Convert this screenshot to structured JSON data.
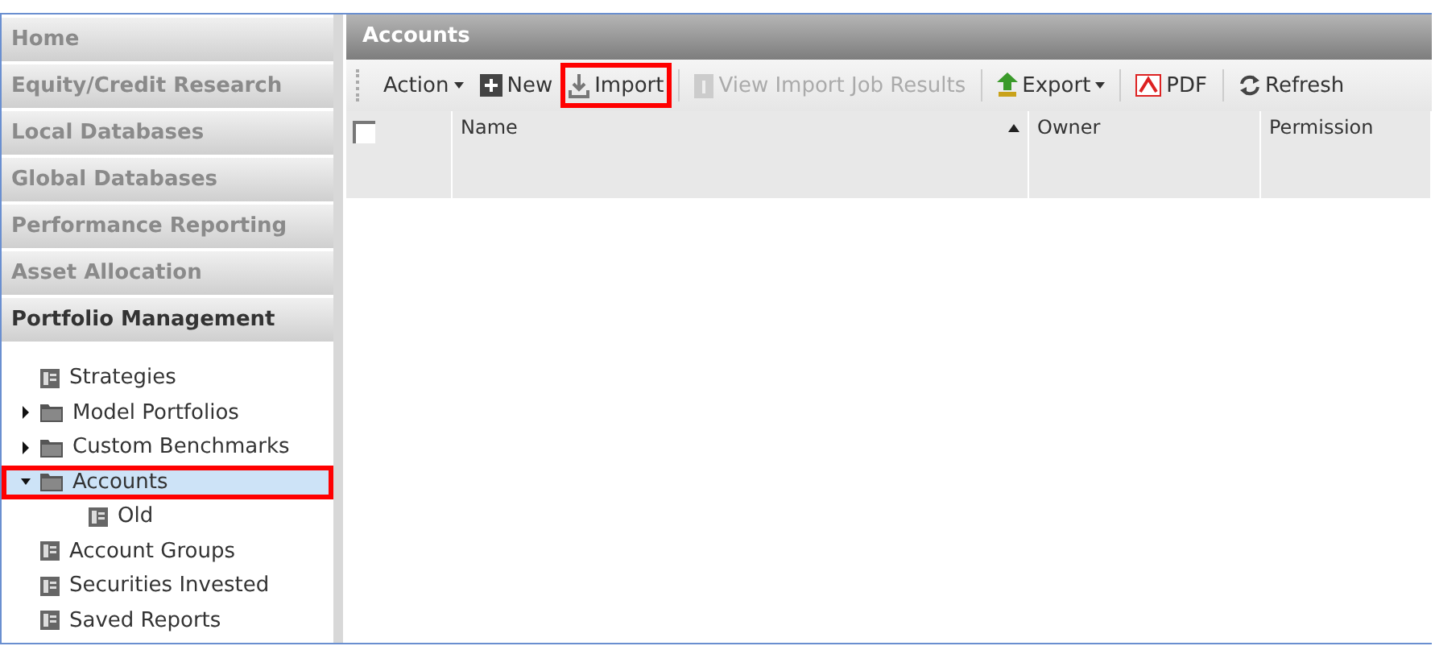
{
  "nav": [
    {
      "label": "Home",
      "selected": false
    },
    {
      "label": "Equity/Credit Research",
      "selected": false
    },
    {
      "label": "Local Databases",
      "selected": false
    },
    {
      "label": "Global Databases",
      "selected": false
    },
    {
      "label": "Performance Reporting",
      "selected": false
    },
    {
      "label": "Asset Allocation",
      "selected": false
    },
    {
      "label": "Portfolio Management",
      "selected": true
    }
  ],
  "tree": [
    {
      "label": "Strategies",
      "kind": "doc",
      "selected": false,
      "highlighted": false
    },
    {
      "label": "Model Portfolios",
      "kind": "folder",
      "expanded": false,
      "selected": false,
      "highlighted": false
    },
    {
      "label": "Custom Benchmarks",
      "kind": "folder",
      "expanded": false,
      "selected": false,
      "highlighted": false
    },
    {
      "label": "Accounts",
      "kind": "folder",
      "expanded": true,
      "selected": true,
      "highlighted": true,
      "children": [
        {
          "label": "Old",
          "kind": "doc",
          "selected": false,
          "highlighted": false
        }
      ]
    },
    {
      "label": "Account Groups",
      "kind": "doc",
      "selected": false,
      "highlighted": false
    },
    {
      "label": "Securities Invested",
      "kind": "doc",
      "selected": false,
      "highlighted": false
    },
    {
      "label": "Saved Reports",
      "kind": "doc",
      "selected": false,
      "highlighted": false
    }
  ],
  "panel": {
    "title": "Accounts"
  },
  "toolbar": [
    {
      "label": "Action",
      "kind": "menu",
      "disabled": false,
      "highlighted": false
    },
    {
      "label": "New",
      "kind": "new",
      "disabled": false,
      "highlighted": false
    },
    {
      "label": "Import",
      "kind": "import",
      "disabled": false,
      "highlighted": true
    },
    {
      "label": "View Import Job Results",
      "kind": "results",
      "disabled": true,
      "highlighted": false
    },
    {
      "label": "Export",
      "kind": "export",
      "disabled": false,
      "highlighted": false
    },
    {
      "label": "PDF",
      "kind": "pdf",
      "disabled": false,
      "highlighted": false
    },
    {
      "label": "Refresh",
      "kind": "refresh",
      "disabled": false,
      "highlighted": false
    }
  ],
  "table": {
    "select_all": {
      "checked": false
    },
    "columns": [
      {
        "label": "Name",
        "sorted": true
      },
      {
        "label": "Owner",
        "sorted": false
      },
      {
        "label": "Permission",
        "sorted": false
      }
    ]
  }
}
